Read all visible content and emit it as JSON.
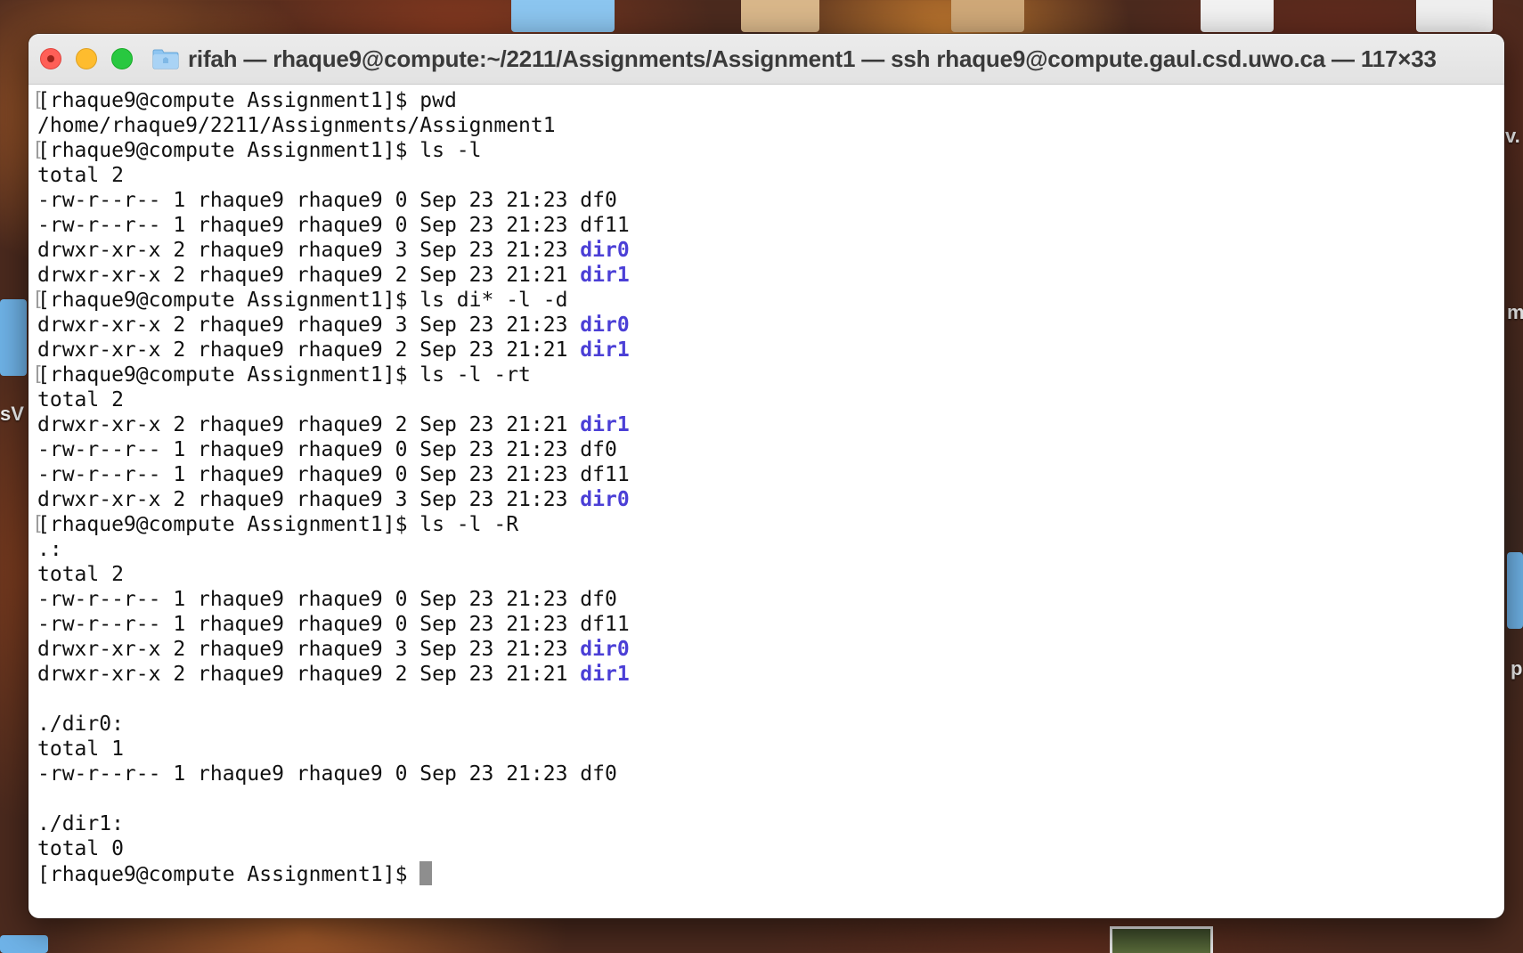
{
  "window": {
    "title": "rifah — rhaque9@compute:~/2211/Assignments/Assignment1 — ssh rhaque9@compute.gaul.csd.uwo.ca — 117×33"
  },
  "desktop": {
    "labels": [
      "sV",
      "m",
      "p",
      "v."
    ]
  },
  "terminal": {
    "lines": [
      {
        "type": "cmd",
        "prompt": "[rhaque9@compute Assignment1]$ ",
        "command": "pwd"
      },
      {
        "type": "out",
        "text": "/home/rhaque9/2211/Assignments/Assignment1"
      },
      {
        "type": "cmd",
        "prompt": "[rhaque9@compute Assignment1]$ ",
        "command": "ls -l"
      },
      {
        "type": "out",
        "text": "total 2"
      },
      {
        "type": "out",
        "text": "-rw-r--r-- 1 rhaque9 rhaque9 0 Sep 23 21:23 ",
        "name": "df0"
      },
      {
        "type": "out",
        "text": "-rw-r--r-- 1 rhaque9 rhaque9 0 Sep 23 21:23 ",
        "name": "df11"
      },
      {
        "type": "out",
        "text": "drwxr-xr-x 2 rhaque9 rhaque9 3 Sep 23 21:23 ",
        "name": "dir0",
        "is_dir": true
      },
      {
        "type": "out",
        "text": "drwxr-xr-x 2 rhaque9 rhaque9 2 Sep 23 21:21 ",
        "name": "dir1",
        "is_dir": true
      },
      {
        "type": "cmd",
        "prompt": "[rhaque9@compute Assignment1]$ ",
        "command": "ls di* -l -d"
      },
      {
        "type": "out",
        "text": "drwxr-xr-x 2 rhaque9 rhaque9 3 Sep 23 21:23 ",
        "name": "dir0",
        "is_dir": true
      },
      {
        "type": "out",
        "text": "drwxr-xr-x 2 rhaque9 rhaque9 2 Sep 23 21:21 ",
        "name": "dir1",
        "is_dir": true
      },
      {
        "type": "cmd",
        "prompt": "[rhaque9@compute Assignment1]$ ",
        "command": "ls -l -rt"
      },
      {
        "type": "out",
        "text": "total 2"
      },
      {
        "type": "out",
        "text": "drwxr-xr-x 2 rhaque9 rhaque9 2 Sep 23 21:21 ",
        "name": "dir1",
        "is_dir": true
      },
      {
        "type": "out",
        "text": "-rw-r--r-- 1 rhaque9 rhaque9 0 Sep 23 21:23 ",
        "name": "df0"
      },
      {
        "type": "out",
        "text": "-rw-r--r-- 1 rhaque9 rhaque9 0 Sep 23 21:23 ",
        "name": "df11"
      },
      {
        "type": "out",
        "text": "drwxr-xr-x 2 rhaque9 rhaque9 3 Sep 23 21:23 ",
        "name": "dir0",
        "is_dir": true
      },
      {
        "type": "cmd",
        "prompt": "[rhaque9@compute Assignment1]$ ",
        "command": "ls -l -R"
      },
      {
        "type": "out",
        "text": ".:"
      },
      {
        "type": "out",
        "text": "total 2"
      },
      {
        "type": "out",
        "text": "-rw-r--r-- 1 rhaque9 rhaque9 0 Sep 23 21:23 ",
        "name": "df0"
      },
      {
        "type": "out",
        "text": "-rw-r--r-- 1 rhaque9 rhaque9 0 Sep 23 21:23 ",
        "name": "df11"
      },
      {
        "type": "out",
        "text": "drwxr-xr-x 2 rhaque9 rhaque9 3 Sep 23 21:23 ",
        "name": "dir0",
        "is_dir": true
      },
      {
        "type": "out",
        "text": "drwxr-xr-x 2 rhaque9 rhaque9 2 Sep 23 21:21 ",
        "name": "dir1",
        "is_dir": true
      },
      {
        "type": "out",
        "text": ""
      },
      {
        "type": "out",
        "text": "./dir0:"
      },
      {
        "type": "out",
        "text": "total 1"
      },
      {
        "type": "out",
        "text": "-rw-r--r-- 1 rhaque9 rhaque9 0 Sep 23 21:23 ",
        "name": "df0"
      },
      {
        "type": "out",
        "text": ""
      },
      {
        "type": "out",
        "text": "./dir1:"
      },
      {
        "type": "out",
        "text": "total 0"
      },
      {
        "type": "prompt",
        "prompt": "[rhaque9@compute Assignment1]$ "
      }
    ]
  },
  "colors": {
    "directory": "#4b3fd6",
    "close": "#ff5f57",
    "minimize": "#febc2e",
    "zoom": "#28c840"
  }
}
